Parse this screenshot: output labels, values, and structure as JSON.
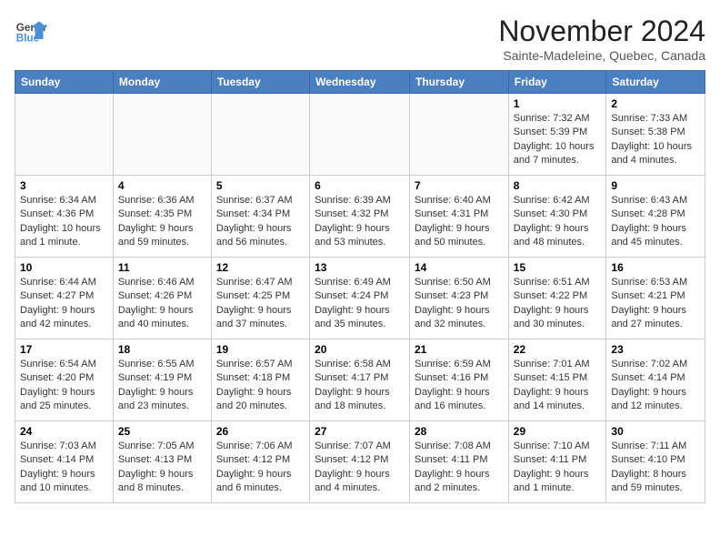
{
  "header": {
    "logo_line1": "General",
    "logo_line2": "Blue",
    "month": "November 2024",
    "location": "Sainte-Madeleine, Quebec, Canada"
  },
  "days_of_week": [
    "Sunday",
    "Monday",
    "Tuesday",
    "Wednesday",
    "Thursday",
    "Friday",
    "Saturday"
  ],
  "weeks": [
    [
      {
        "day": "",
        "info": ""
      },
      {
        "day": "",
        "info": ""
      },
      {
        "day": "",
        "info": ""
      },
      {
        "day": "",
        "info": ""
      },
      {
        "day": "",
        "info": ""
      },
      {
        "day": "1",
        "info": "Sunrise: 7:32 AM\nSunset: 5:39 PM\nDaylight: 10 hours and 7 minutes."
      },
      {
        "day": "2",
        "info": "Sunrise: 7:33 AM\nSunset: 5:38 PM\nDaylight: 10 hours and 4 minutes."
      }
    ],
    [
      {
        "day": "3",
        "info": "Sunrise: 6:34 AM\nSunset: 4:36 PM\nDaylight: 10 hours and 1 minute."
      },
      {
        "day": "4",
        "info": "Sunrise: 6:36 AM\nSunset: 4:35 PM\nDaylight: 9 hours and 59 minutes."
      },
      {
        "day": "5",
        "info": "Sunrise: 6:37 AM\nSunset: 4:34 PM\nDaylight: 9 hours and 56 minutes."
      },
      {
        "day": "6",
        "info": "Sunrise: 6:39 AM\nSunset: 4:32 PM\nDaylight: 9 hours and 53 minutes."
      },
      {
        "day": "7",
        "info": "Sunrise: 6:40 AM\nSunset: 4:31 PM\nDaylight: 9 hours and 50 minutes."
      },
      {
        "day": "8",
        "info": "Sunrise: 6:42 AM\nSunset: 4:30 PM\nDaylight: 9 hours and 48 minutes."
      },
      {
        "day": "9",
        "info": "Sunrise: 6:43 AM\nSunset: 4:28 PM\nDaylight: 9 hours and 45 minutes."
      }
    ],
    [
      {
        "day": "10",
        "info": "Sunrise: 6:44 AM\nSunset: 4:27 PM\nDaylight: 9 hours and 42 minutes."
      },
      {
        "day": "11",
        "info": "Sunrise: 6:46 AM\nSunset: 4:26 PM\nDaylight: 9 hours and 40 minutes."
      },
      {
        "day": "12",
        "info": "Sunrise: 6:47 AM\nSunset: 4:25 PM\nDaylight: 9 hours and 37 minutes."
      },
      {
        "day": "13",
        "info": "Sunrise: 6:49 AM\nSunset: 4:24 PM\nDaylight: 9 hours and 35 minutes."
      },
      {
        "day": "14",
        "info": "Sunrise: 6:50 AM\nSunset: 4:23 PM\nDaylight: 9 hours and 32 minutes."
      },
      {
        "day": "15",
        "info": "Sunrise: 6:51 AM\nSunset: 4:22 PM\nDaylight: 9 hours and 30 minutes."
      },
      {
        "day": "16",
        "info": "Sunrise: 6:53 AM\nSunset: 4:21 PM\nDaylight: 9 hours and 27 minutes."
      }
    ],
    [
      {
        "day": "17",
        "info": "Sunrise: 6:54 AM\nSunset: 4:20 PM\nDaylight: 9 hours and 25 minutes."
      },
      {
        "day": "18",
        "info": "Sunrise: 6:55 AM\nSunset: 4:19 PM\nDaylight: 9 hours and 23 minutes."
      },
      {
        "day": "19",
        "info": "Sunrise: 6:57 AM\nSunset: 4:18 PM\nDaylight: 9 hours and 20 minutes."
      },
      {
        "day": "20",
        "info": "Sunrise: 6:58 AM\nSunset: 4:17 PM\nDaylight: 9 hours and 18 minutes."
      },
      {
        "day": "21",
        "info": "Sunrise: 6:59 AM\nSunset: 4:16 PM\nDaylight: 9 hours and 16 minutes."
      },
      {
        "day": "22",
        "info": "Sunrise: 7:01 AM\nSunset: 4:15 PM\nDaylight: 9 hours and 14 minutes."
      },
      {
        "day": "23",
        "info": "Sunrise: 7:02 AM\nSunset: 4:14 PM\nDaylight: 9 hours and 12 minutes."
      }
    ],
    [
      {
        "day": "24",
        "info": "Sunrise: 7:03 AM\nSunset: 4:14 PM\nDaylight: 9 hours and 10 minutes."
      },
      {
        "day": "25",
        "info": "Sunrise: 7:05 AM\nSunset: 4:13 PM\nDaylight: 9 hours and 8 minutes."
      },
      {
        "day": "26",
        "info": "Sunrise: 7:06 AM\nSunset: 4:12 PM\nDaylight: 9 hours and 6 minutes."
      },
      {
        "day": "27",
        "info": "Sunrise: 7:07 AM\nSunset: 4:12 PM\nDaylight: 9 hours and 4 minutes."
      },
      {
        "day": "28",
        "info": "Sunrise: 7:08 AM\nSunset: 4:11 PM\nDaylight: 9 hours and 2 minutes."
      },
      {
        "day": "29",
        "info": "Sunrise: 7:10 AM\nSunset: 4:11 PM\nDaylight: 9 hours and 1 minute."
      },
      {
        "day": "30",
        "info": "Sunrise: 7:11 AM\nSunset: 4:10 PM\nDaylight: 8 hours and 59 minutes."
      }
    ]
  ]
}
